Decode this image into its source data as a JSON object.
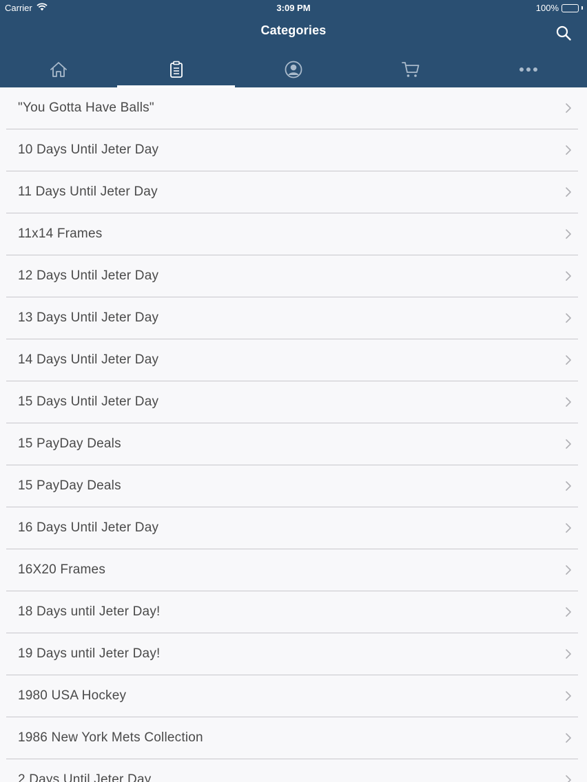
{
  "status_bar": {
    "carrier": "Carrier",
    "time": "3:09 PM",
    "battery": "100%"
  },
  "nav": {
    "title": "Categories",
    "search_icon": "search-icon"
  },
  "tabs": [
    {
      "icon": "home-icon",
      "active": false
    },
    {
      "icon": "clipboard-icon",
      "active": true
    },
    {
      "icon": "user-icon",
      "active": false
    },
    {
      "icon": "cart-icon",
      "active": false
    },
    {
      "icon": "more-icon",
      "active": false
    }
  ],
  "colors": {
    "header_bg": "#2a4f72",
    "list_bg": "#f8f8fa",
    "row_text": "#4a4a4a",
    "separator": "#c8c7cc",
    "chevron": "#b0b0b5"
  },
  "categories": [
    "\"You Gotta Have Balls\"",
    "10 Days Until Jeter Day",
    "11 Days Until Jeter Day",
    "11x14 Frames",
    "12 Days Until Jeter Day",
    "13 Days Until Jeter Day",
    "14 Days Until Jeter Day",
    "15 Days Until Jeter Day",
    "15 PayDay Deals",
    "15 PayDay Deals",
    "16 Days Until Jeter Day",
    "16X20 Frames",
    "18 Days until Jeter Day!",
    "19 Days until Jeter Day!",
    "1980 USA Hockey",
    "1986 New York Mets Collection",
    "2 Days Until Jeter Day"
  ]
}
